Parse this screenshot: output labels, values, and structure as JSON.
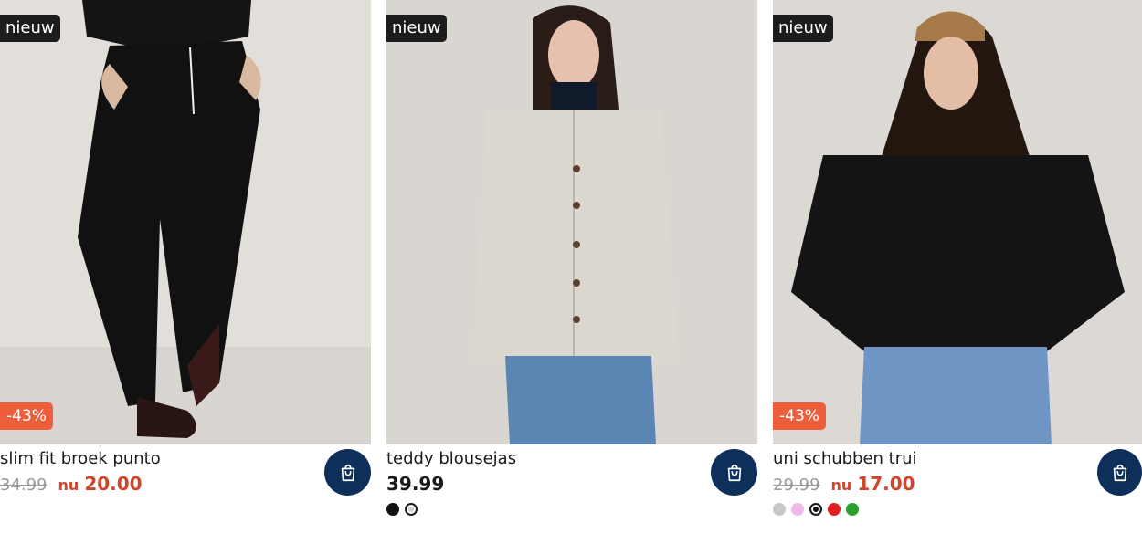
{
  "products": [
    {
      "badge": "nieuw",
      "discount": "-43%",
      "title": "slim fit broek punto",
      "old_price": "34.99",
      "now_label": "nu",
      "price": "20.00",
      "swatches": []
    },
    {
      "badge": "nieuw",
      "discount": "",
      "title": "teddy blousejas",
      "old_price": "",
      "now_label": "",
      "price": "39.99",
      "swatches": [
        "#111111",
        "#cfcfcf"
      ]
    },
    {
      "badge": "nieuw",
      "discount": "-43%",
      "title": "uni schubben trui",
      "old_price": "29.99",
      "now_label": "nu",
      "price": "17.00",
      "swatches": [
        "#c8c8c8",
        "#f0b8e8",
        "#111111",
        "#e02020",
        "#2aa02a"
      ]
    }
  ],
  "icons": {
    "cart": "shopping-bag-icon"
  },
  "colors": {
    "cart_button": "#0e2f5a",
    "discount": "#ef5e3b",
    "sale_price": "#d0442a",
    "badge": "#1c1c1c"
  }
}
